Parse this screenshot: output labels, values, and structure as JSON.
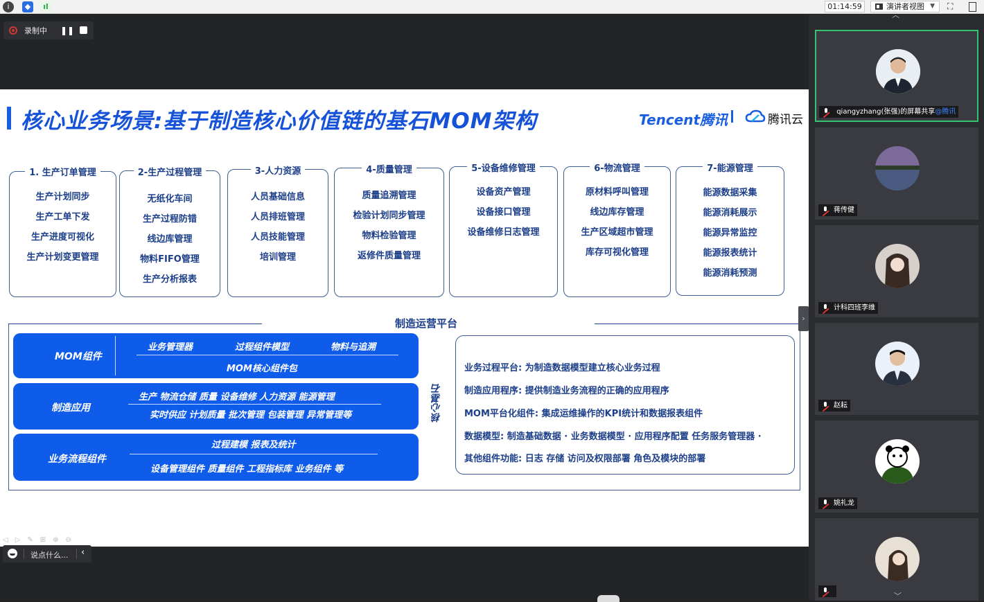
{
  "topbar": {
    "timer": "01:14:59",
    "view_mode": "演讲者视图",
    "icons": [
      "info-icon",
      "shield-icon",
      "signal-icon",
      "fullscreen-icon",
      "window-icon"
    ]
  },
  "recording": {
    "label": "录制中"
  },
  "slide": {
    "title": "核心业务场景:基于制造核心价值链的基石MOM架构",
    "logo_tencent": "Tencent腾讯",
    "logo_cloud": "腾讯云",
    "modules": [
      {
        "title": "1. 生产订单管理",
        "items": [
          "生产计划同步",
          "生产工单下发",
          "生产进度可视化",
          "生产计划变更管理"
        ]
      },
      {
        "title": "2-生产过程管理",
        "items": [
          "无纸化车间",
          "生产过程防错",
          "线边库管理",
          "物料FIFO管理",
          "生产分析报表"
        ]
      },
      {
        "title": "3-人力资源",
        "items": [
          "人员基础信息",
          "人员排班管理",
          "人员技能管理",
          "培训管理"
        ]
      },
      {
        "title": "4-质量管理",
        "items": [
          "质量追溯管理",
          "检验计划同步管理",
          "物料检验管理",
          "返修件质量管理"
        ]
      },
      {
        "title": "5-设备维修管理",
        "items": [
          "设备资产管理",
          "设备接口管理",
          "设备维修日志管理"
        ]
      },
      {
        "title": "6-物流管理",
        "items": [
          "原材料呼叫管理",
          "线边库存管理",
          "生产区域超市管理",
          "库存可视化管理"
        ]
      },
      {
        "title": "7-能源管理",
        "items": [
          "能源数据采集",
          "能源消耗展示",
          "能源异常监控",
          "能源报表统计",
          "能源消耗预测"
        ]
      }
    ],
    "platform": {
      "label": "制造运营平台",
      "mom": {
        "label": "MOM组件",
        "row1": [
          "业务管理器",
          "过程组件模型",
          "物料与追溯"
        ],
        "row2": "MOM核心组件包"
      },
      "apps": {
        "label": "制造应用",
        "row1": "生产  物流仓储  质量  设备维修   人力资源  能源管理",
        "row2": "实时供应 计划质量 批次管理 包装管理 异常管理等"
      },
      "flow": {
        "label": "业务流程组件",
        "row1": "过程建模  报表及统计",
        "row2": "设备管理组件 质量组件  工程指标库 业务组件 等"
      },
      "core_label": "核心基石",
      "info": [
        "业务过程平台: 为制造数据模型建立核心业务过程",
        "制造应用程序: 提供制造业务流程的正确的应用程序",
        "MOM平台化组件: 集成运维操作的KPI统计和数据报表组件",
        "数据模型: 制造基础数据 · 业务数据模型 · 应用程序配置 任务服务管理器 ·",
        "其他组件功能: 日志 存储 访问及权限部署 角色及模块的部署"
      ]
    }
  },
  "chat": {
    "placeholder": "说点什么..."
  },
  "participants": [
    {
      "name": "qiangyzhang(张强)的屏幕共享",
      "tag": "@腾讯",
      "active": true,
      "avatar_color": "#e9eef3"
    },
    {
      "name": "蒋传健",
      "tag": "",
      "active": false,
      "avatar_color": "#6b5f7e"
    },
    {
      "name": "计科四班李维",
      "tag": "",
      "active": false,
      "avatar_color": "#5a4a44"
    },
    {
      "name": "赵耘",
      "tag": "",
      "active": false,
      "avatar_color": "#eaf1fb"
    },
    {
      "name": "姚礼龙",
      "tag": "",
      "active": false,
      "avatar_color": "#4a5a3a"
    },
    {
      "name": "",
      "tag": "",
      "active": false,
      "avatar_color": "#c9b9a6"
    }
  ]
}
